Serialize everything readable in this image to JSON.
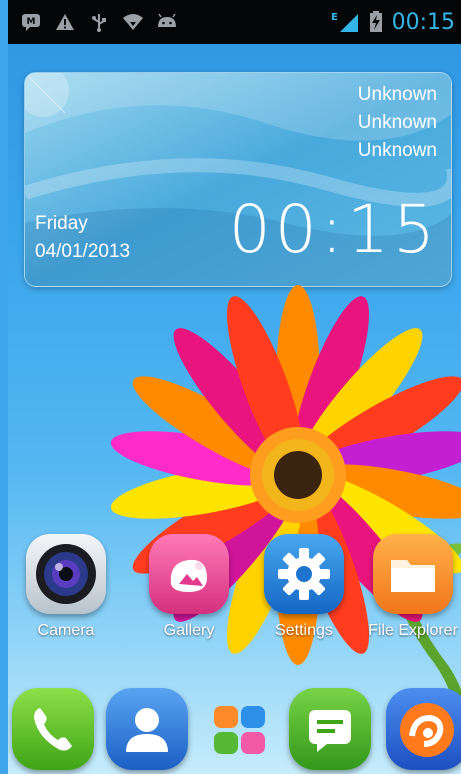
{
  "status_bar": {
    "time": "00:15",
    "network": "E",
    "left_icons": [
      "message-icon",
      "warning-icon",
      "usb-icon",
      "wifi-icon",
      "android-icon"
    ],
    "right_icons": [
      "signal-icon",
      "battery-charging-icon"
    ]
  },
  "widget": {
    "weather_lines": [
      "Unknown",
      "Unknown",
      "Unknown"
    ],
    "day": "Friday",
    "date": "04/01/2013",
    "time": "00:15"
  },
  "apps": [
    {
      "label": "Camera",
      "icon": "camera-icon"
    },
    {
      "label": "Gallery",
      "icon": "gallery-icon"
    },
    {
      "label": "Settings",
      "icon": "settings-icon"
    },
    {
      "label": "File Explorer",
      "icon": "folder-icon"
    }
  ],
  "dock": [
    {
      "icon": "phone-icon"
    },
    {
      "icon": "contacts-icon"
    },
    {
      "icon": "app-drawer-icon"
    },
    {
      "icon": "messaging-icon"
    },
    {
      "icon": "uc-browser-icon"
    }
  ],
  "colors": {
    "status_accent": "#34b5e8",
    "wallpaper_sky": "#3aa4ec"
  }
}
